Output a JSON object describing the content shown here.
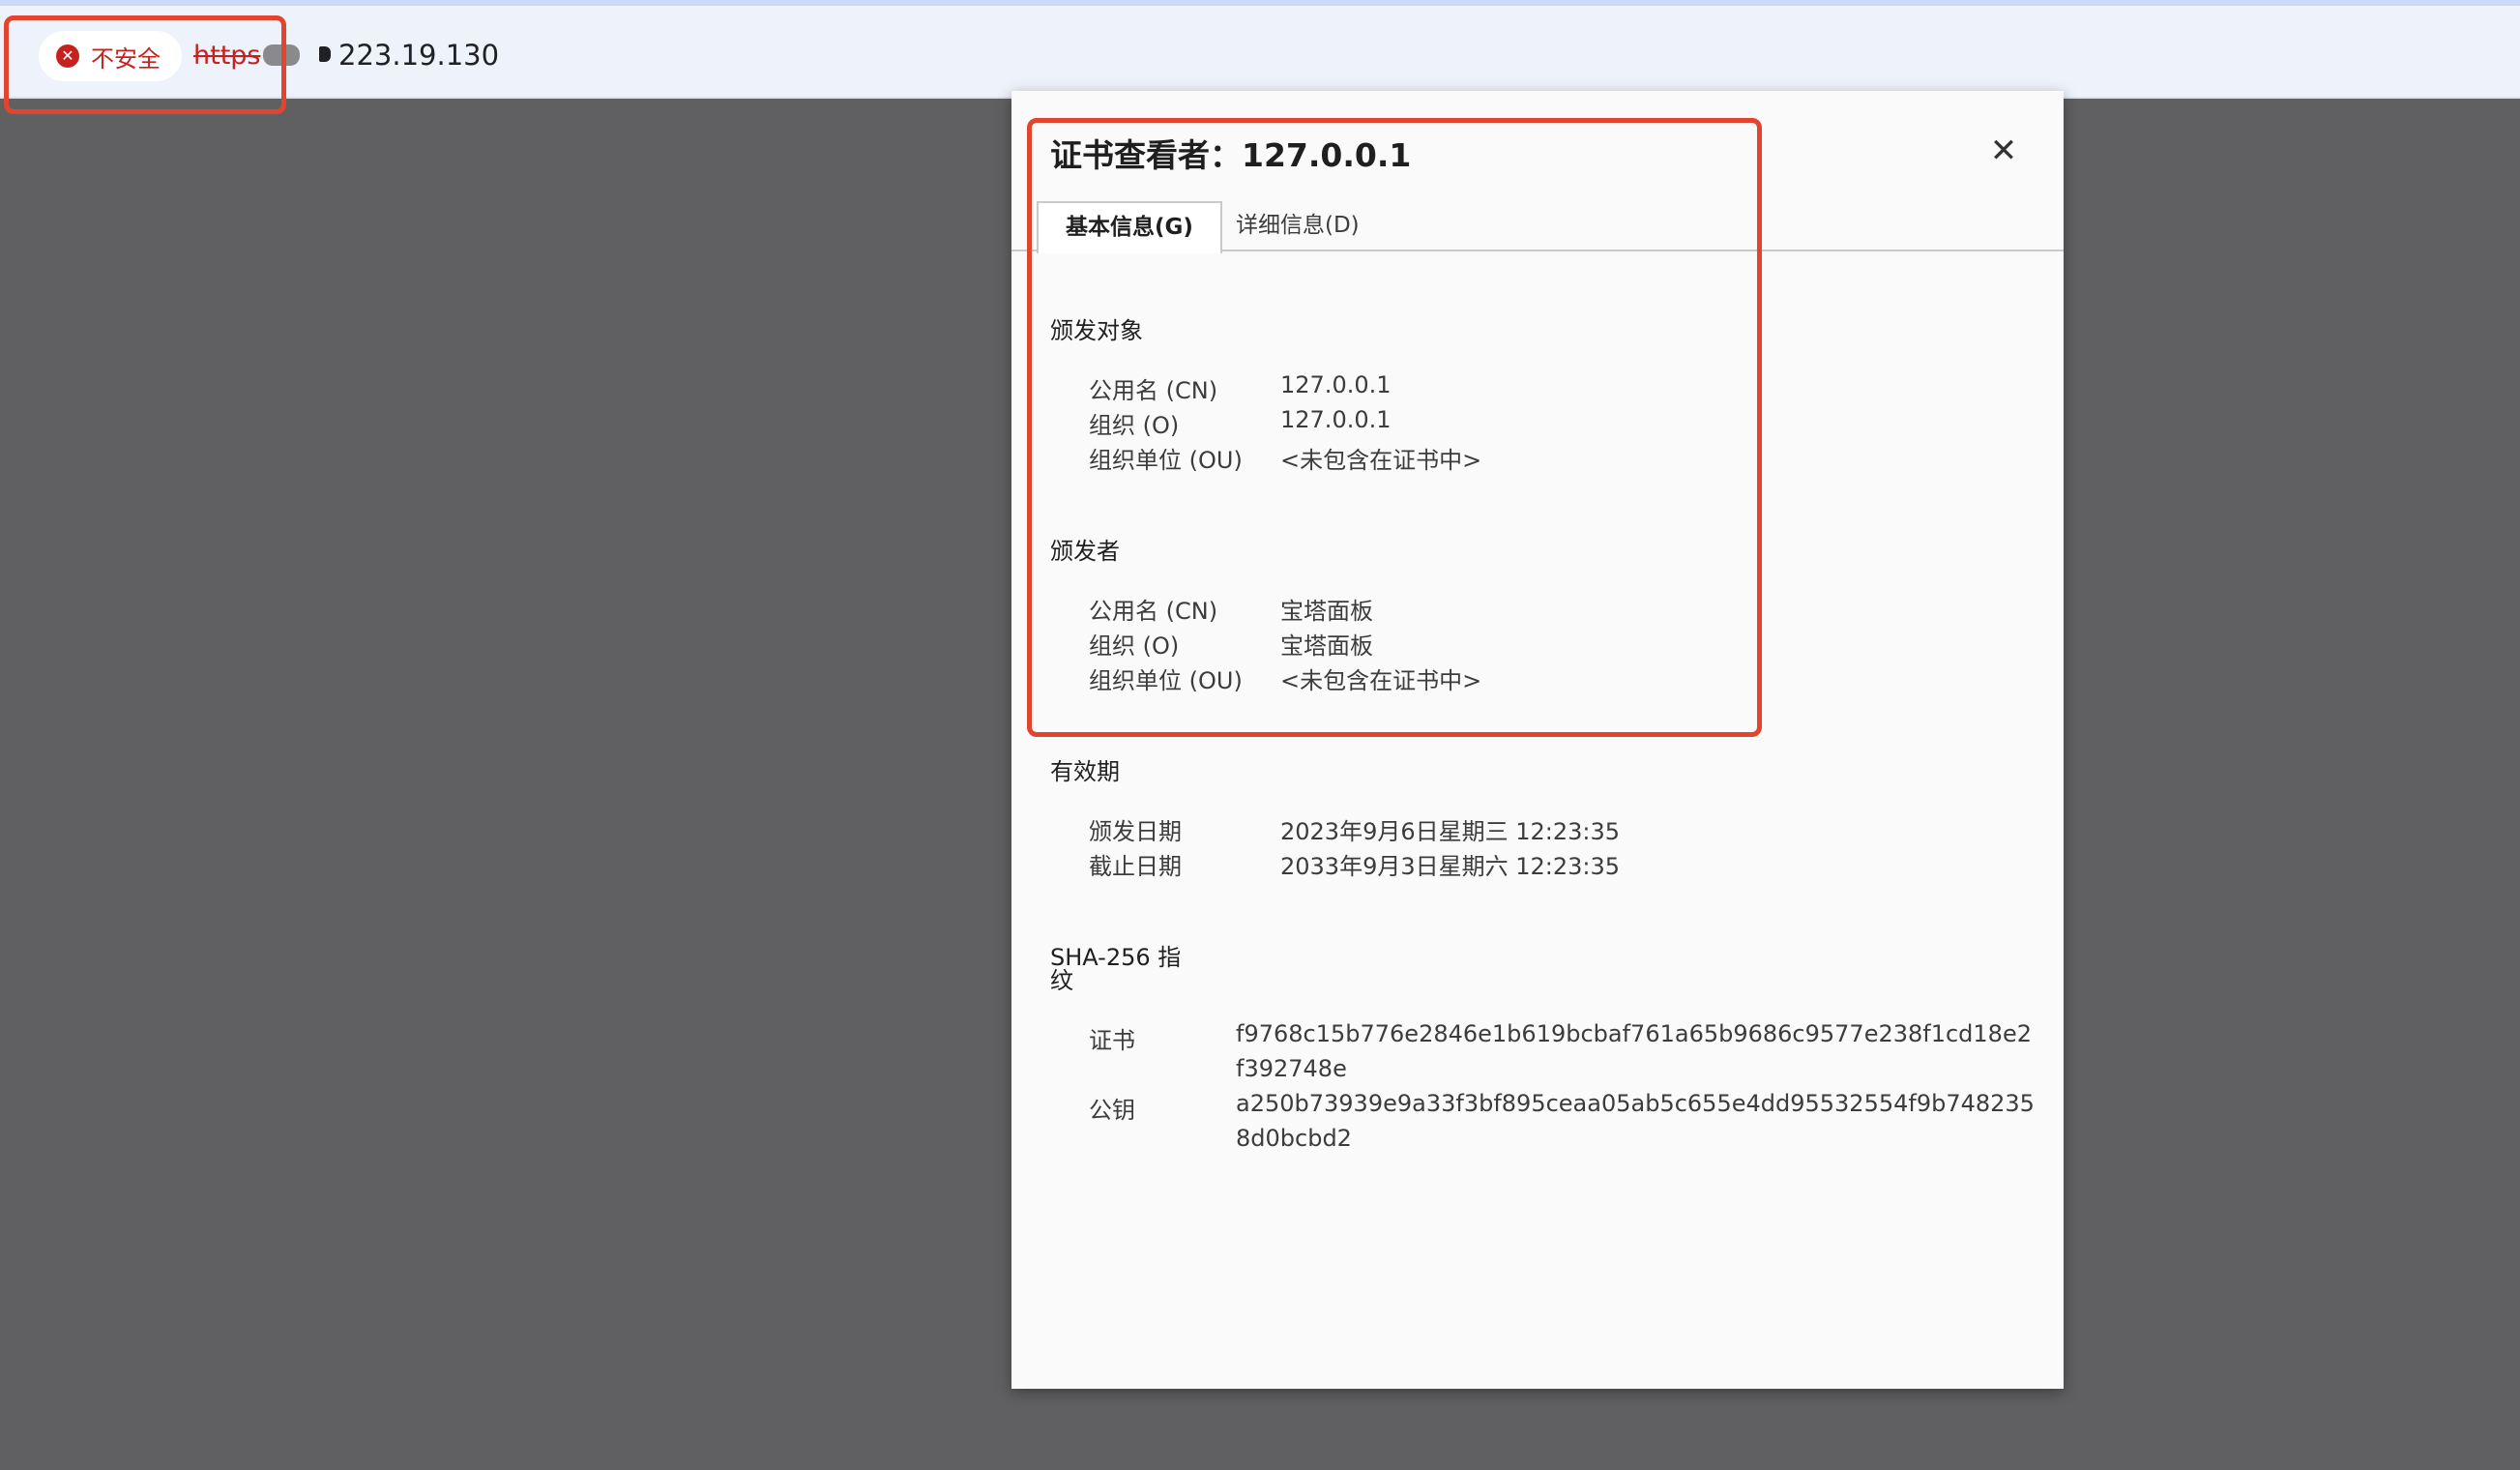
{
  "browser": {
    "security_label": "不安全",
    "url_scheme": "https",
    "url_host": "223.19.130"
  },
  "dialog": {
    "title": "证书查看者：127.0.0.1",
    "close_glyph": "✕",
    "tabs": [
      {
        "label": "基本信息(G)",
        "active": true
      },
      {
        "label": "详细信息(D)",
        "active": false
      }
    ],
    "subject": {
      "title": "颁发对象",
      "rows": [
        {
          "label": "公用名 (CN)",
          "value": "127.0.0.1"
        },
        {
          "label": "组织 (O)",
          "value": "127.0.0.1"
        },
        {
          "label": "组织单位 (OU)",
          "value": "<未包含在证书中>"
        }
      ]
    },
    "issuer": {
      "title": "颁发者",
      "rows": [
        {
          "label": "公用名 (CN)",
          "value": "宝塔面板"
        },
        {
          "label": "组织 (O)",
          "value": "宝塔面板"
        },
        {
          "label": "组织单位 (OU)",
          "value": "<未包含在证书中>"
        }
      ]
    },
    "validity": {
      "title": "有效期",
      "rows": [
        {
          "label": "颁发日期",
          "value": "2023年9月6日星期三 12:23:35"
        },
        {
          "label": "截止日期",
          "value": "2033年9月3日星期六 12:23:35"
        }
      ]
    },
    "fingerprints": {
      "title_line1": "SHA-256 指",
      "title_line2": "纹",
      "rows": [
        {
          "label": "证书",
          "value": "f9768c15b776e2846e1b619bcbaf761a65b9686c9577e238f1cd18e2f392748e"
        },
        {
          "label": "公钥",
          "value": "a250b73939e9a33f3bf895ceaa05ab5c655e4dd95532554f9b7482358d0bcbd2"
        }
      ]
    }
  },
  "colors": {
    "annotation": "#e1452f",
    "insecure": "#c5221f",
    "backdrop": "#606062"
  }
}
